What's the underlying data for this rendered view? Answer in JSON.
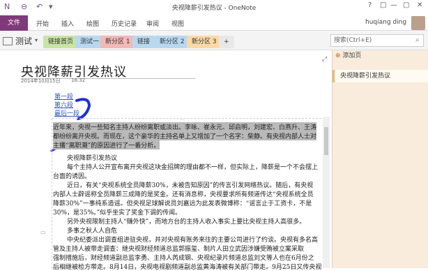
{
  "window": {
    "title": "央视降薪引发热议 - OneNote",
    "controls": [
      "?",
      "□",
      "—",
      "▢",
      "✕"
    ]
  },
  "ribbon": {
    "file": "文件",
    "tabs": [
      "开始",
      "插入",
      "绘图",
      "历史记录",
      "审阅",
      "视图"
    ],
    "user": "huqiang ding"
  },
  "notebook": {
    "name": "测试",
    "sections": [
      {
        "label": "链接首页",
        "color": "#c9e4a4"
      },
      {
        "label": "测试一",
        "color": "#b8d8f0"
      },
      {
        "label": "新分区 1",
        "color": "#f3b8b8"
      },
      {
        "label": "链接",
        "color": "#b8d8f0"
      },
      {
        "label": "新分区 2",
        "color": "#b8d8f0"
      },
      {
        "label": "新分区 3",
        "color": "#f9d9a6"
      }
    ],
    "add_section": "+"
  },
  "search": {
    "placeholder": "搜索(Ctrl+E)"
  },
  "page": {
    "title": "央视降薪引发热议",
    "date": "2014年10月15日",
    "time": "16:32",
    "links": [
      "第一段",
      "第六段",
      "最后一段"
    ]
  },
  "content": {
    "lines": [
      "近年来，央视一些知名主持人纷纷离职或淡出。李咏、崔永元、邱启明，刘建宏、白燕升、王涛",
      "都纷纷离开央视。而现在，这个豪华的主持名单上又增加了一个名字：柴静。有央视内部人士对",
      "主播“离职潮”的原因进行了一番分析。",
      "央视降薪引发热议",
      "每个主持人公开宣布离开央视这块金招牌的理由都不一样，但实际上，降薪是一个不会摆上",
      "台面的诱因。",
      "近日，有关“央视系统全员降薪30%，未被告知原因”的传言引发网络热议。随后，有央视",
      "内部人士辟谣称全员降薪三成降的是奖金。还有消息称，央视要求所有频道传达“央视系统全员",
      "降薪30%”一事纯系造谣。但央视足球解说员刘嘉远为此发表微博称：“谣言止于工资卡，不是",
      "30%，是35%。”似乎坐实了奖金下调的传闻。",
      "另外央视限制主持人“赚外快”，而地方台的主持人收入事实上要比央视主持人高很多。",
      "多事之秋人人自危",
      "中央纪委派出调查组进驻央视，并对央视有账务来往的主要公司进行了约谈。央视有多名高",
      "管及主持人被带走调查：继央视财经频道总监郭振玺、制片人田立武因涉嫌受贿被立案采取",
      "强制措施后，财经频道副总监李勇、主持人芮成钢、央视纪录片频道总监刘文等人也在6月份之",
      "后相继被检方带走。8月14日，央视电视剧频道副总监黄海涛被有关部门带走。9月25日又传央视"
    ]
  },
  "pages_pane": {
    "add_page": "添加页",
    "pages": [
      "央视降薪引发热议"
    ]
  }
}
